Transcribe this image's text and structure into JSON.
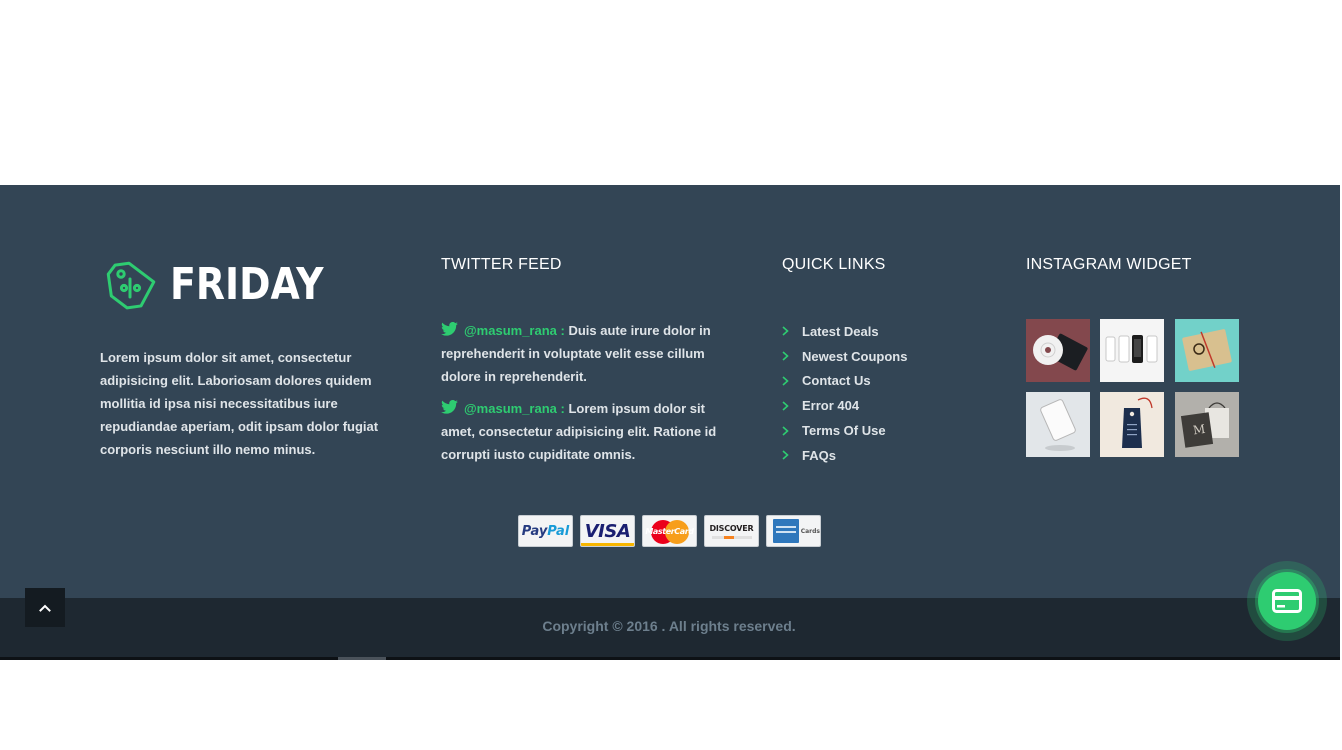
{
  "brand": {
    "name": "FRIDAY",
    "about": "Lorem ipsum dolor sit amet, consectetur adipisicing elit. Laboriosam dolores quidem mollitia id ipsa nisi necessitatibus iure repudiandae aperiam, odit ipsam dolor fugiat corporis nesciunt illo nemo minus."
  },
  "twitter": {
    "title": "TWITTER FEED",
    "tweets": [
      {
        "handle": "@masum_rana :",
        "text": " Duis aute irure dolor in reprehenderit in voluptate velit esse cillum dolore in reprehenderit."
      },
      {
        "handle": "@masum_rana :",
        "text": " Lorem ipsum dolor sit amet, consectetur adipisicing elit. Ratione id corrupti iusto cupiditate omnis."
      }
    ]
  },
  "quick_links": {
    "title": "QUICK LINKS",
    "items": [
      "Latest Deals",
      "Newest Coupons",
      "Contact Us",
      "Error 404",
      "Terms Of Use",
      "FAQs"
    ]
  },
  "instagram": {
    "title": "INSTAGRAM WIDGET"
  },
  "payments": {
    "paypal": {
      "part1": "Pay",
      "part2": "Pal"
    },
    "visa": "VISA",
    "mastercard": "MasterCard",
    "discover": "DISCOVER",
    "amex": "Cards"
  },
  "footer": {
    "copyright": "Copyright © 2016 . All rights reserved."
  },
  "colors": {
    "accent": "#2ecc71",
    "footer_bg": "#334555",
    "footer_bottom_bg": "#1e2831"
  }
}
